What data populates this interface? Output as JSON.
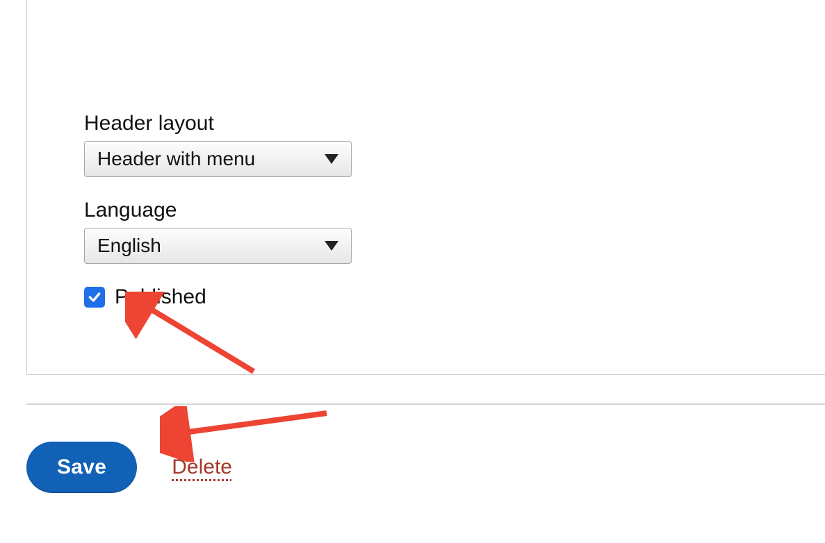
{
  "fields": {
    "header_layout": {
      "label": "Header layout",
      "value": "Header with menu"
    },
    "language": {
      "label": "Language",
      "value": "English"
    },
    "published": {
      "label": "Published",
      "checked": true
    }
  },
  "actions": {
    "save_label": "Save",
    "delete_label": "Delete"
  },
  "colors": {
    "primary_button": "#1161b6",
    "checkbox": "#1f6fe8",
    "delete_link": "#a23a2a",
    "annotation_arrow": "#ee4433"
  }
}
